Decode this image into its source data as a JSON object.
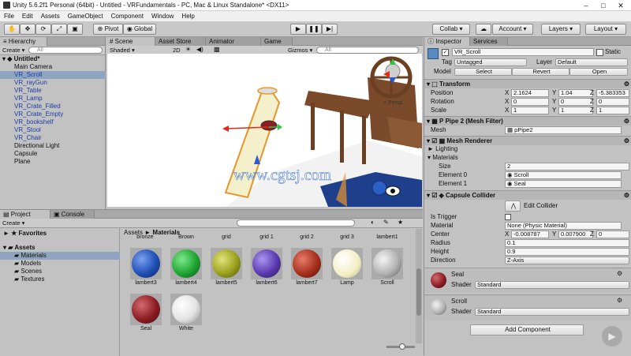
{
  "window": {
    "title": "Unity 5.6.2f1 Personal (64bit) - Untitled - VRFundamentals - PC, Mac & Linux Standalone* <DX11>",
    "min": "–",
    "max": "□",
    "close": "✕"
  },
  "menu": [
    "File",
    "Edit",
    "Assets",
    "GameObject",
    "Component",
    "Window",
    "Help"
  ],
  "toolbar": {
    "pivot": "Pivot",
    "global": "Global",
    "collab": "Collab",
    "account": "Account",
    "layers": "Layers",
    "layout": "Layout"
  },
  "hierarchy": {
    "tab": "Hierarchy",
    "create": "Create",
    "search": "All",
    "scene": "Untitled*",
    "items": [
      {
        "label": "Main Camera",
        "color": "black"
      },
      {
        "label": "VR_Scroll",
        "color": "blue",
        "selected": true
      },
      {
        "label": "VR_rayGun",
        "color": "blue"
      },
      {
        "label": "VR_Table",
        "color": "blue"
      },
      {
        "label": "VR_Lamp",
        "color": "blue"
      },
      {
        "label": "VR_Crate_Filled",
        "color": "blue"
      },
      {
        "label": "VR_Crate_Empty",
        "color": "blue"
      },
      {
        "label": "VR_bookshelf",
        "color": "blue"
      },
      {
        "label": "VR_Stool",
        "color": "blue"
      },
      {
        "label": "VR_Chair",
        "color": "blue"
      },
      {
        "label": "Directional Light",
        "color": "black"
      },
      {
        "label": "Capsule",
        "color": "black"
      },
      {
        "label": "Plane",
        "color": "black"
      }
    ]
  },
  "scene_tabs": {
    "scene": "Scene",
    "asset_store": "Asset Store",
    "animator": "Animator",
    "game": "Game",
    "shaded": "Shaded",
    "mode2d": "2D",
    "gizmos": "Gizmos",
    "search": "All",
    "persp": "< Persp"
  },
  "watermark": "www.cgtsj.com",
  "project": {
    "tab": "Project",
    "console": "Console",
    "create": "Create",
    "breadcrumb": {
      "root": "Assets",
      "sep": "►",
      "current": "Materials"
    },
    "favorites": "Favorites",
    "assets": "Assets",
    "folders": [
      "Materials",
      "Models",
      "Scenes",
      "Textures"
    ],
    "top_labels": [
      "bronze",
      "Brown",
      "grid",
      "grid 1",
      "grid 2",
      "grid 3",
      "lambert1"
    ],
    "materials": [
      {
        "name": "lambert3",
        "color": "#1f4fb5"
      },
      {
        "name": "lambert4",
        "color": "#1fa531"
      },
      {
        "name": "lambert5",
        "color": "#9ba11c"
      },
      {
        "name": "lambert6",
        "color": "#5b3ab0"
      },
      {
        "name": "lambert7",
        "color": "#a8301d"
      },
      {
        "name": "Lamp",
        "color": "#f3efc4"
      },
      {
        "name": "Scroll",
        "color": "#b3b3b3"
      },
      {
        "name": "Seal",
        "color": "#8c1d23"
      },
      {
        "name": "White",
        "color": "#e3e3e3"
      }
    ]
  },
  "inspector": {
    "tab": "Inspector",
    "services": "Services",
    "name": "VR_Scroll",
    "static": "Static",
    "tag_label": "Tag",
    "tag": "Untagged",
    "layer_label": "Layer",
    "layer": "Default",
    "model_label": "Model",
    "select": "Select",
    "revert": "Revert",
    "open": "Open",
    "transform": {
      "title": "Transform",
      "position": "Position",
      "rotation": "Rotation",
      "scale": "Scale",
      "pos": [
        "2.1624",
        "1.04",
        "-5.383353"
      ],
      "rot": [
        "0",
        "0",
        "0"
      ],
      "scl": [
        "1",
        "1",
        "1"
      ],
      "x": "X",
      "y": "Y",
      "z": "Z"
    },
    "meshfilter": {
      "title": "P Pipe 2 (Mesh Filter)",
      "mesh_label": "Mesh",
      "mesh": "pPipe2"
    },
    "renderer": {
      "title": "Mesh Renderer",
      "lighting": "Lighting",
      "materials": "Materials",
      "size_label": "Size",
      "size": "2",
      "e0_label": "Element 0",
      "e0": "Scroll",
      "e1_label": "Element 1",
      "e1": "Seal"
    },
    "collider": {
      "title": "Capsule Collider",
      "edit": "Edit Collider",
      "trigger": "Is Trigger",
      "material_label": "Material",
      "material": "None (Physic Material)",
      "center_label": "Center",
      "center": [
        "-0.008787",
        "0.007900",
        "0"
      ],
      "radius_label": "Radius",
      "radius": "0.1",
      "height_label": "Height",
      "height": "0.9",
      "direction_label": "Direction",
      "direction": "Z-Axis"
    },
    "seal": {
      "name": "Seal",
      "shader_label": "Shader",
      "shader": "Standard"
    },
    "scroll": {
      "name": "Scroll",
      "shader_label": "Shader",
      "shader": "Standard"
    },
    "add_component": "Add Component"
  }
}
